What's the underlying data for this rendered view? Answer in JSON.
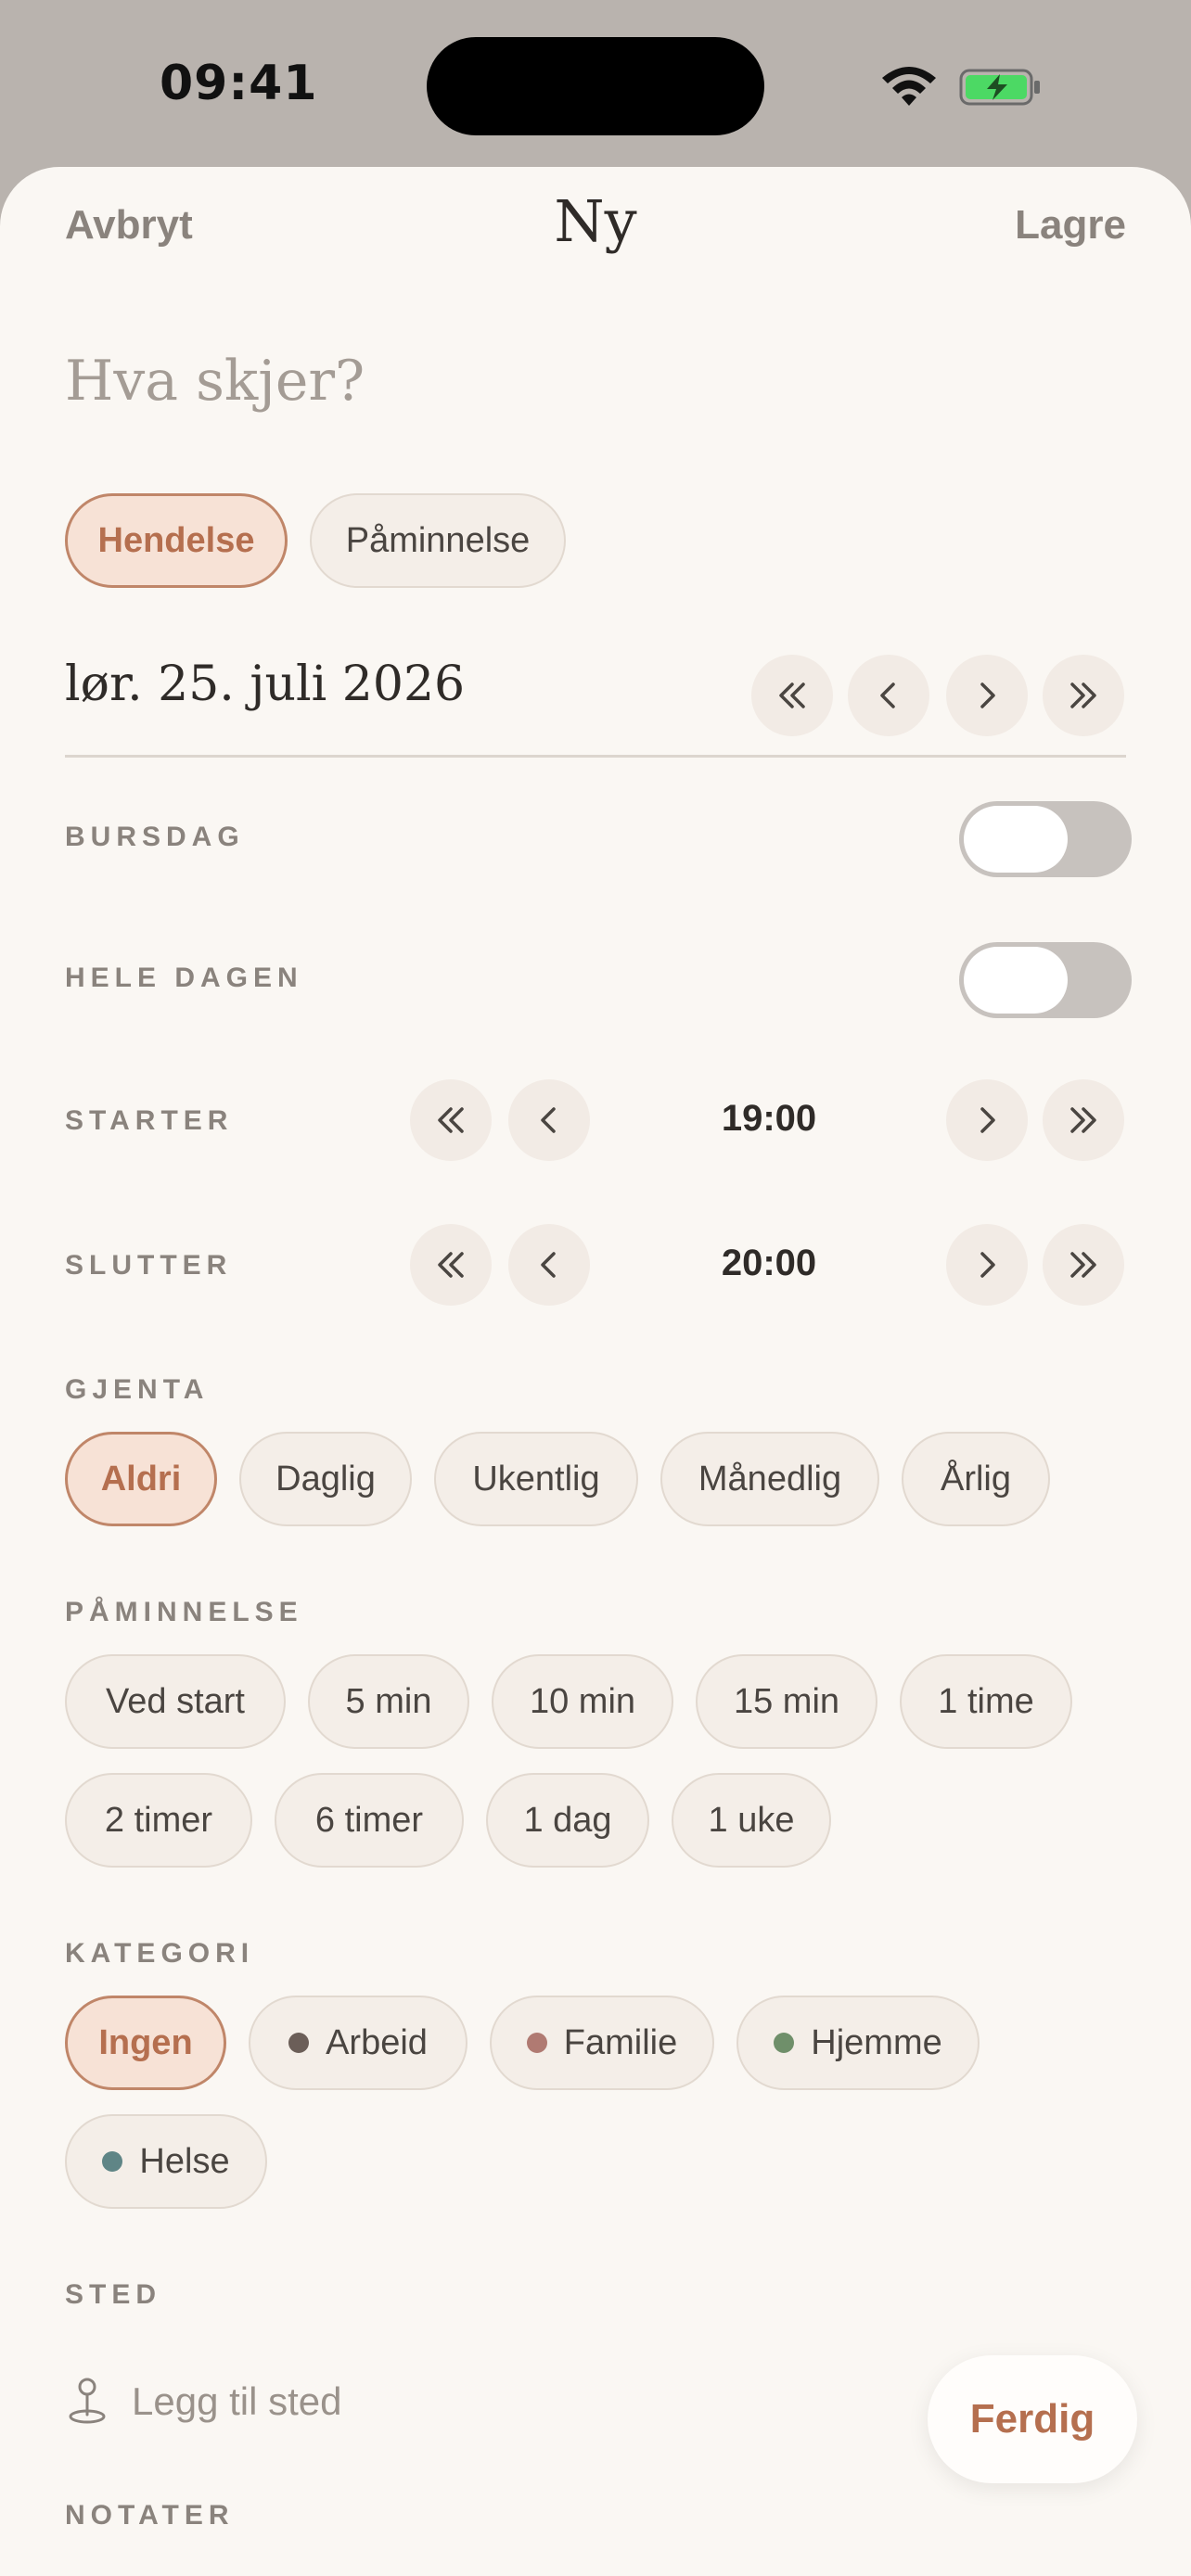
{
  "status": {
    "time": "09:41"
  },
  "nav": {
    "cancel": "Avbryt",
    "title": "Ny",
    "save": "Lagre"
  },
  "title_placeholder": "Hva skjer?",
  "type_options": [
    {
      "label": "Hendelse",
      "selected": true
    },
    {
      "label": "Påminnelse",
      "selected": false
    }
  ],
  "date": {
    "value": "lør. 25. juli 2026"
  },
  "birthday": {
    "label": "BURSDAG",
    "on": false
  },
  "all_day": {
    "label": "HELE DAGEN",
    "on": false
  },
  "start": {
    "label": "STARTER",
    "time": "19:00"
  },
  "end": {
    "label": "SLUTTER",
    "time": "20:00"
  },
  "repeat": {
    "label": "GJENTA",
    "options": [
      "Aldri",
      "Daglig",
      "Ukentlig",
      "Månedlig",
      "Årlig"
    ],
    "selected": "Aldri"
  },
  "reminder": {
    "label": "PÅMINNELSE",
    "options": [
      "Ved start",
      "5 min",
      "10 min",
      "15 min",
      "1 time",
      "2 timer",
      "6 timer",
      "1 dag",
      "1 uke"
    ]
  },
  "category": {
    "label": "KATEGORI",
    "options": [
      {
        "label": "Ingen",
        "color": null,
        "selected": true
      },
      {
        "label": "Arbeid",
        "color": "#6b5e58",
        "selected": false
      },
      {
        "label": "Familie",
        "color": "#b07a72",
        "selected": false
      },
      {
        "label": "Hjemme",
        "color": "#6f8f6a",
        "selected": false
      },
      {
        "label": "Helse",
        "color": "#5f8586",
        "selected": false
      }
    ]
  },
  "location": {
    "label": "STED",
    "placeholder": "Legg til sted"
  },
  "notes": {
    "label": "NOTATER"
  },
  "done": "Ferdig",
  "colors": {
    "accent": "#b56f4f",
    "accent_bg": "#f7e2d6",
    "sheet_bg": "#faf7f3"
  }
}
